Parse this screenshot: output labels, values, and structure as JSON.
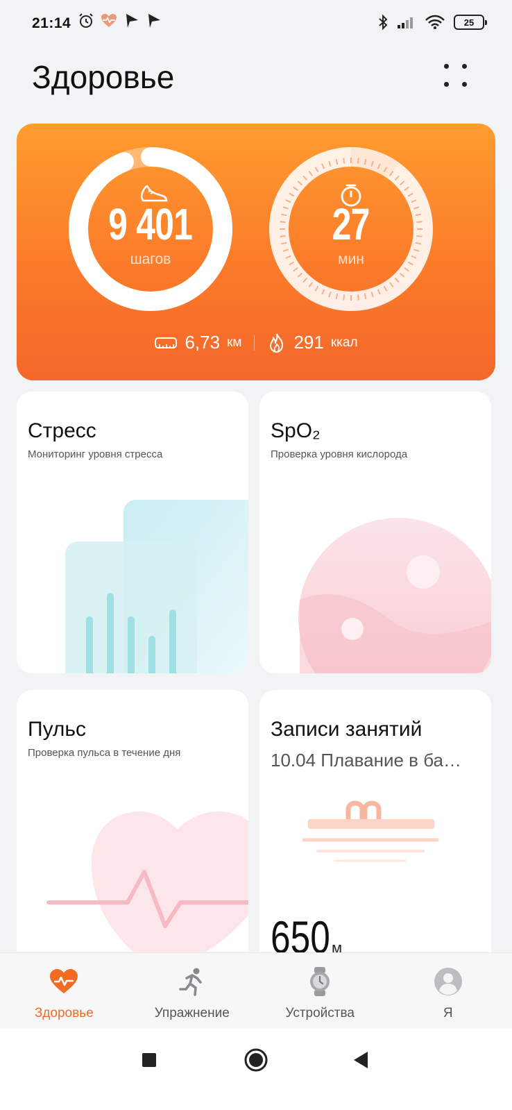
{
  "status_bar": {
    "time": "21:14",
    "battery": "25",
    "left_icons": [
      "alarm-icon",
      "heart-health-icon",
      "play-icon",
      "play-icon"
    ],
    "right_icons": [
      "bluetooth-icon",
      "signal-icon",
      "wifi-icon",
      "battery-icon"
    ]
  },
  "header": {
    "title": "Здоровье",
    "menu_icon": "grid-dots-icon"
  },
  "activity": {
    "steps_value": "9 401",
    "steps_unit": "шагов",
    "steps_progress": 0.94,
    "minutes_value": "27",
    "minutes_unit": "мин",
    "minutes_progress": 0.1,
    "distance_value": "6,73",
    "distance_unit": "км",
    "calories_value": "291",
    "calories_unit": "ккал",
    "colors": {
      "gradient_top": "#ff9c2f",
      "gradient_bottom": "#f4672a"
    }
  },
  "tiles": {
    "stress": {
      "title": "Стресс",
      "subtitle": "Мониторинг уровня стресса"
    },
    "spo2": {
      "title": "SpO₂",
      "subtitle": "Проверка уровня кислорода"
    },
    "pulse": {
      "title": "Пульс",
      "subtitle": "Проверка пульса в течение дня"
    },
    "workouts": {
      "title": "Записи занятий",
      "subtitle": "10.04 Плавание в ба…",
      "value": "650",
      "unit": "м"
    }
  },
  "bottom_nav": {
    "items": [
      {
        "label": "Здоровье",
        "icon": "heart-pulse-icon",
        "active": true
      },
      {
        "label": "Упражнение",
        "icon": "running-icon",
        "active": false
      },
      {
        "label": "Устройства",
        "icon": "watch-icon",
        "active": false
      },
      {
        "label": "Я",
        "icon": "avatar-icon",
        "active": false
      }
    ],
    "accent": "#f26b22"
  },
  "system_nav": [
    "recents-button",
    "home-button",
    "back-button"
  ]
}
